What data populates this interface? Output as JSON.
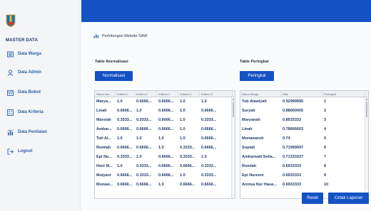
{
  "sidebar": {
    "menu_title": "MASTER DATA",
    "items": [
      {
        "label": "Data Warga",
        "icon": "list-icon"
      },
      {
        "label": "Data Admin",
        "icon": "user-icon"
      },
      {
        "label": "Data Bobot",
        "icon": "calendar-icon"
      },
      {
        "label": "Data Kriteria",
        "icon": "list-check-icon"
      },
      {
        "label": "Data Penilaian",
        "icon": "bar-chart-icon"
      },
      {
        "label": "Logout",
        "icon": "logout-icon"
      }
    ]
  },
  "colors": {
    "accent": "#1451c4",
    "sidebar_bg": "#f4f5f7",
    "link": "#2b5fa8"
  },
  "main": {
    "title": "Perhitungan Metode SAW",
    "normalisasi": {
      "section_label": "Table Normalisasi",
      "button_label": "Normalisasi",
      "columns": [
        "Nama Wa...",
        "Kriteria 1",
        "Kriteria 2",
        "Kriteria 3",
        "Kriteria 4",
        "Kriteria 5"
      ],
      "rows": [
        [
          "Marya...",
          "1.0",
          "0.6666...",
          "0.6666...",
          "1.0",
          "1.0"
        ],
        [
          "Linah",
          "0.6666...",
          "1.0",
          "0.6666...",
          "1.0",
          "0.6666..."
        ],
        [
          "Marsiah",
          "0.3333...",
          "0.3333...",
          "0.6666...",
          "1.0",
          "0.3333..."
        ],
        [
          "Ambar...",
          "0.6666...",
          "0.6666...",
          "0.6666...",
          "1.0",
          "0.6666..."
        ],
        [
          "Tuti Al...",
          "1.0",
          "1.0",
          "1.0",
          "1.0",
          "0.6666..."
        ],
        [
          "Romlah",
          "0.6666...",
          "0.6666...",
          "1.0",
          "0.3333...",
          "0.6666..."
        ],
        [
          "Epi Nu...",
          "0.3333...",
          "1.0",
          "0.6666...",
          "0.3333...",
          "1.0"
        ],
        [
          "Heni M...",
          "1.0",
          "0.3333...",
          "0.6666...",
          "0.6666...",
          "0.3333..."
        ],
        [
          "Mulyani",
          "0.6666...",
          "0.3333...",
          "0.6666...",
          "1.0",
          "0.3333..."
        ],
        [
          "Munaw...",
          "0.6666...",
          "0.6666...",
          "1.0",
          "0.6666...",
          "0.6666..."
        ]
      ]
    },
    "peringkat": {
      "section_label": "Table Peringkat",
      "button_label": "Peringkat",
      "columns": [
        "Nama Warga",
        "Nilai",
        "Peringkat"
      ],
      "rows": [
        [
          "Tuti Alawiyah",
          "0.92999995",
          "1"
        ],
        [
          "Suryati",
          "0.88000005",
          "2"
        ],
        [
          "Maryanah",
          "0.8533333",
          "3"
        ],
        [
          "Linah",
          "0.78666663",
          "4"
        ],
        [
          "Munawaroh",
          "0.74",
          "5"
        ],
        [
          "Sopiah",
          "0.71999997",
          "6"
        ],
        [
          "Ambarwati Setia...",
          "0.71333337",
          "7"
        ],
        [
          "Romlah",
          "0.6933333",
          "8"
        ],
        [
          "Epi Nureeni",
          "0.6933333",
          "9"
        ],
        [
          "Annisa Nur Hasa...",
          "0.6933333",
          "10"
        ]
      ]
    },
    "reset_label": "Reset",
    "print_label": "Cetak Laporan"
  }
}
